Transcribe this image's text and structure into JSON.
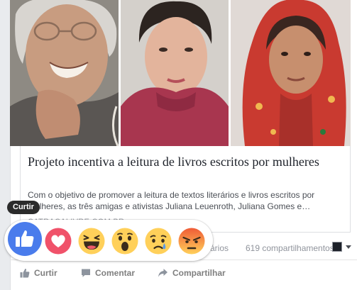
{
  "post": {
    "photos": [
      {
        "name": "Elderly woman smiling"
      },
      {
        "name": "Woman with dark updo"
      },
      {
        "name": "Young woman in red headscarf"
      }
    ],
    "link_title": "Projeto incentiva a leitura de livros escritos por mulheres",
    "link_description": "Com o objetivo de promover a leitura de textos literários e livros escritos por mulheres, as três amigas e ativistas Juliana Leuenroth, Juliana Gomes e…",
    "link_domain": "CATRACALIVRE.COM.BR"
  },
  "stats": {
    "comments_fragment": "ários",
    "shares": "619 compartilhamentos"
  },
  "actions": {
    "like_label": "Curtir",
    "comment_label": "Comentar",
    "share_label": "Compartilhar"
  },
  "tooltip": {
    "label": "Curtir"
  },
  "reactions": [
    {
      "name": "like",
      "icon": "thumbs-up-icon"
    },
    {
      "name": "love",
      "icon": "heart-icon"
    },
    {
      "name": "haha",
      "icon": "laughing-face-icon"
    },
    {
      "name": "wow",
      "icon": "surprised-face-icon"
    },
    {
      "name": "sad",
      "icon": "crying-face-icon"
    },
    {
      "name": "angry",
      "icon": "angry-face-icon"
    }
  ],
  "colors": {
    "like_blue": "#4a7cec",
    "love_red": "#f0526a",
    "emoji_yellow": "#ffd05a",
    "angry_red": "#ef5b36",
    "page_background": "#e9ebee",
    "text_dark": "#1d2129",
    "text_muted": "#90949c"
  }
}
